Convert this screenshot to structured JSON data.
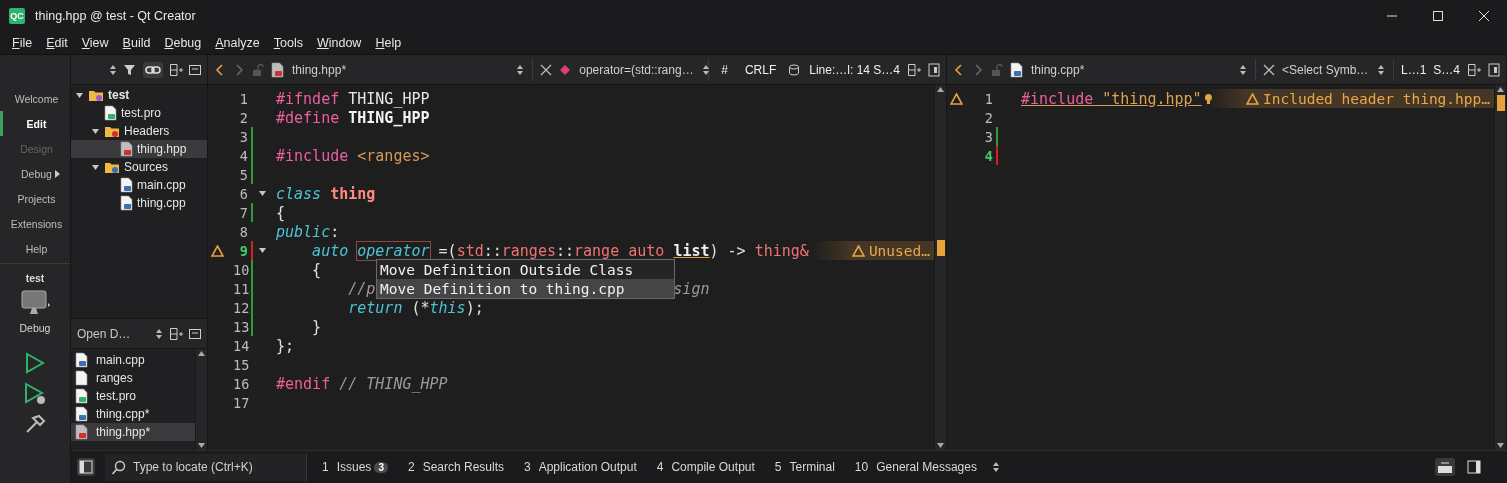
{
  "window": {
    "logo": "QC",
    "title": "thing.hpp @ test - Qt Creator"
  },
  "menu": [
    "File",
    "Edit",
    "View",
    "Build",
    "Debug",
    "Analyze",
    "Tools",
    "Window",
    "Help"
  ],
  "modes": [
    {
      "label": "Welcome",
      "selected": false,
      "disabled": false,
      "submenu": false
    },
    {
      "label": "Edit",
      "selected": true,
      "disabled": false,
      "submenu": false
    },
    {
      "label": "Design",
      "selected": false,
      "disabled": true,
      "submenu": false
    },
    {
      "label": "Debug",
      "selected": false,
      "disabled": false,
      "submenu": true
    },
    {
      "label": "Projects",
      "selected": false,
      "disabled": false,
      "submenu": false
    },
    {
      "label": "Extensions",
      "selected": false,
      "disabled": false,
      "submenu": false
    },
    {
      "label": "Help",
      "selected": false,
      "disabled": false,
      "submenu": false
    }
  ],
  "kit": {
    "project": "test",
    "build": "Debug"
  },
  "project_tree": [
    {
      "label": "test",
      "kind": "project",
      "selected": false,
      "expanded": true,
      "children": [
        {
          "label": "test.pro",
          "kind": "pro",
          "selected": false
        },
        {
          "label": "Headers",
          "kind": "headers",
          "selected": false,
          "expanded": true,
          "children": [
            {
              "label": "thing.hpp",
              "kind": "hpp",
              "selected": true
            }
          ]
        },
        {
          "label": "Sources",
          "kind": "sources",
          "selected": false,
          "expanded": true,
          "children": [
            {
              "label": "main.cpp",
              "kind": "cpp",
              "selected": false
            },
            {
              "label": "thing.cpp",
              "kind": "cpp",
              "selected": false
            }
          ]
        }
      ]
    }
  ],
  "open_documents": {
    "title": "Open D…",
    "items": [
      {
        "label": "main.cpp",
        "kind": "cpp",
        "selected": false
      },
      {
        "label": "ranges",
        "kind": "plain",
        "selected": false
      },
      {
        "label": "test.pro",
        "kind": "pro",
        "selected": false
      },
      {
        "label": "thing.cpp*",
        "kind": "cpp",
        "selected": false
      },
      {
        "label": "thing.hpp*",
        "kind": "hpp",
        "selected": true
      }
    ]
  },
  "editors": [
    {
      "file": "thing.hpp*",
      "kind": "hpp",
      "symbol": {
        "kind": "function",
        "label": "operator=(std::rang…"
      },
      "indicators": [
        "#",
        "CRLF"
      ],
      "position": [
        "Line:…l: 14 S…4"
      ],
      "popup": [
        {
          "label": "Move Definition Outside Class",
          "selected": false
        },
        {
          "label": "Move Definition to thing.cpp",
          "selected": true
        }
      ],
      "lines": [
        {
          "n": "1",
          "added": false,
          "modified": false,
          "current": false,
          "warning": false,
          "fold": false,
          "tokens": [
            {
              "t": "#ifndef",
              "kind": "pp"
            },
            {
              "t": " THING_HPP",
              "kind": "mac"
            }
          ]
        },
        {
          "n": "2",
          "added": false,
          "modified": false,
          "current": false,
          "warning": false,
          "fold": false,
          "tokens": [
            {
              "t": "#define",
              "kind": "pp"
            },
            {
              "t": " THING_HPP",
              "kind": "macb"
            }
          ]
        },
        {
          "n": "3",
          "added": true,
          "modified": false,
          "current": false,
          "warning": false,
          "fold": false
        },
        {
          "n": "4",
          "added": true,
          "modified": false,
          "current": false,
          "warning": false,
          "fold": false,
          "tokens": [
            {
              "t": "#include",
              "kind": "pp"
            },
            {
              "t": " <ranges>",
              "kind": "inc"
            }
          ]
        },
        {
          "n": "5",
          "added": true,
          "modified": false,
          "current": false,
          "warning": false,
          "fold": false
        },
        {
          "n": "6",
          "added": false,
          "modified": false,
          "current": false,
          "warning": false,
          "fold": true,
          "tokens": [
            {
              "t": "class",
              "kind": "kw"
            },
            {
              "t": "thing",
              "kind": "cls"
            }
          ]
        },
        {
          "n": "7",
          "added": true,
          "modified": false,
          "current": false,
          "warning": false,
          "fold": false,
          "tokens": [
            {
              "t": "{",
              "kind": "pl"
            }
          ]
        },
        {
          "n": "8",
          "added": false,
          "modified": false,
          "current": false,
          "warning": false,
          "fold": false,
          "tokens": [
            {
              "t": "public",
              "kind": "kw"
            },
            {
              "t": ":",
              "kind": "pl"
            }
          ]
        },
        {
          "n": "9",
          "added": false,
          "modified": true,
          "current": true,
          "warning": true,
          "fold": true,
          "annotation": "Unused…",
          "tokens": [
            {
              "t": "    auto ",
              "kind": "kw"
            },
            {
              "t": "operator",
              "kind": "kwbox"
            },
            {
              "t": " =(",
              "kind": "pl"
            },
            {
              "t": "std",
              "kind": "typ"
            },
            {
              "t": "::",
              "kind": "pl"
            },
            {
              "t": "ranges",
              "kind": "typ"
            },
            {
              "t": "::",
              "kind": "pl"
            },
            {
              "t": "range auto ",
              "kind": "typ"
            },
            {
              "t": "list",
              "kind": "par"
            },
            {
              "t": ") -> ",
              "kind": "pl"
            },
            {
              "t": "thing&",
              "kind": "typ"
            }
          ]
        },
        {
          "n": "10",
          "added": true,
          "modified": false,
          "current": false,
          "warning": false,
          "fold": false,
          "tokens": [
            {
              "t": "    {",
              "kind": "pl"
            }
          ]
        },
        {
          "n": "11",
          "added": true,
          "modified": false,
          "current": false,
          "warning": false,
          "fold": false,
          "tokens": [
            {
              "t": "        //p",
              "kind": "cmt"
            },
            {
              "t": "sign",
              "kind": "cmt_after_overlay"
            }
          ]
        },
        {
          "n": "12",
          "added": true,
          "modified": false,
          "current": false,
          "warning": false,
          "fold": false,
          "tokens": [
            {
              "t": "        return",
              "kind": "kw"
            },
            {
              "t": " (*",
              "kind": "pl"
            },
            {
              "t": "this",
              "kind": "kw"
            },
            {
              "t": ");",
              "kind": "pl"
            }
          ]
        },
        {
          "n": "13",
          "added": true,
          "modified": false,
          "current": false,
          "warning": false,
          "fold": false,
          "tokens": [
            {
              "t": "    }",
              "kind": "pl"
            }
          ]
        },
        {
          "n": "14",
          "added": false,
          "modified": false,
          "current": false,
          "warning": false,
          "fold": false,
          "tokens": [
            {
              "t": "};",
              "kind": "pl"
            }
          ]
        },
        {
          "n": "15",
          "added": false,
          "modified": false,
          "current": false,
          "warning": false,
          "fold": false
        },
        {
          "n": "16",
          "added": false,
          "modified": false,
          "current": false,
          "warning": false,
          "fold": false,
          "tokens": [
            {
              "t": "#endif",
              "kind": "pp"
            },
            {
              "t": " // THING_HPP",
              "kind": "cmt"
            }
          ]
        },
        {
          "n": "17",
          "added": false,
          "modified": false,
          "current": false,
          "warning": false,
          "fold": false
        }
      ]
    },
    {
      "file": "thing.cpp*",
      "kind": "cpp",
      "symbol": {
        "kind": "placeholder",
        "label": "<Select Symb…"
      },
      "position": [
        "L…1",
        "S…4"
      ],
      "lines": [
        {
          "n": "1",
          "added": false,
          "modified": false,
          "current": false,
          "warning": true,
          "fold": false,
          "hint": true,
          "annotation": "Included header thing.hpp…",
          "tokens": [
            {
              "t": "#include",
              "kind": "ppu"
            },
            {
              "t": " \"thing.hpp\"",
              "kind": "incu"
            }
          ]
        },
        {
          "n": "2",
          "added": false,
          "modified": false,
          "current": false,
          "warning": false,
          "fold": false,
          "hint": false
        },
        {
          "n": "3",
          "added": true,
          "modified": false,
          "current": false,
          "warning": false,
          "fold": false,
          "hint": false
        },
        {
          "n": "4",
          "added": false,
          "modified": true,
          "current": true,
          "warning": false,
          "fold": false,
          "hint": false
        }
      ]
    }
  ],
  "locate": {
    "placeholder": "Type to locate (Ctrl+K)"
  },
  "output_panes": [
    {
      "number": "1",
      "label": "Issues",
      "badge": "3"
    },
    {
      "number": "2",
      "label": "Search Results"
    },
    {
      "number": "3",
      "label": "Application Output"
    },
    {
      "number": "4",
      "label": "Compile Output"
    },
    {
      "number": "5",
      "label": "Terminal"
    },
    {
      "number": "10",
      "label": "General Messages"
    }
  ]
}
